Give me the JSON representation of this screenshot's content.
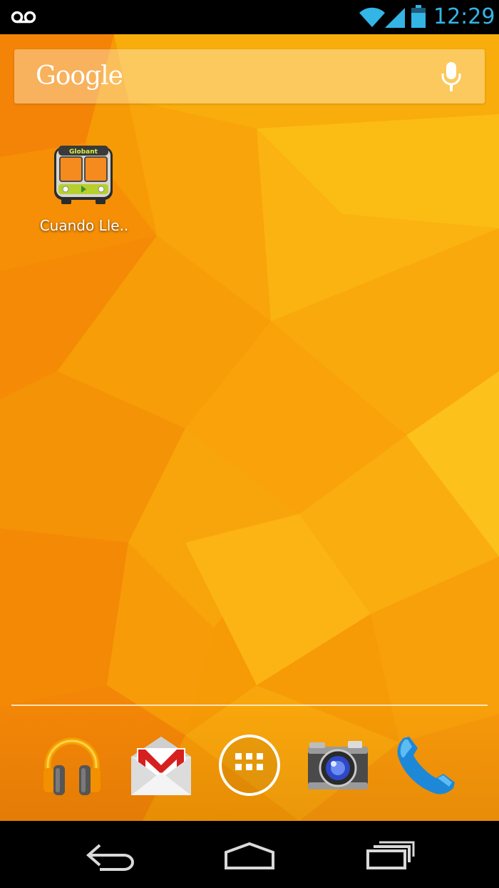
{
  "status_bar": {
    "time": "12:29",
    "icons": [
      "voicemail-icon",
      "wifi-icon",
      "signal-icon",
      "battery-icon"
    ],
    "accent_color": "#33b5e5"
  },
  "search_widget": {
    "logo_text": "Google",
    "mic_icon": "mic-icon"
  },
  "home_shortcuts": [
    {
      "label": "Cuando Lle..",
      "icon": "bus-icon",
      "icon_text": "Globant"
    }
  ],
  "dock": {
    "items": [
      {
        "name": "play-music",
        "icon": "headphones-icon"
      },
      {
        "name": "gmail",
        "icon": "gmail-icon"
      },
      {
        "name": "all-apps",
        "icon": "app-drawer-icon"
      },
      {
        "name": "camera",
        "icon": "camera-icon"
      },
      {
        "name": "phone",
        "icon": "phone-icon"
      }
    ]
  },
  "nav_bar": {
    "buttons": [
      "back",
      "home",
      "recents"
    ]
  },
  "theme": {
    "wallpaper_primary": "#f59a08",
    "wallpaper_light": "#fbbb16",
    "wallpaper_dark": "#f07a00"
  }
}
